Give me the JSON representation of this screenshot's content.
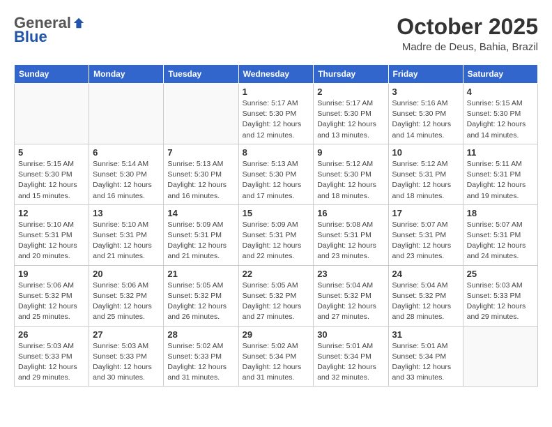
{
  "header": {
    "logo_general": "General",
    "logo_blue": "Blue",
    "month_title": "October 2025",
    "location": "Madre de Deus, Bahia, Brazil"
  },
  "weekdays": [
    "Sunday",
    "Monday",
    "Tuesday",
    "Wednesday",
    "Thursday",
    "Friday",
    "Saturday"
  ],
  "weeks": [
    [
      {
        "day": "",
        "info": ""
      },
      {
        "day": "",
        "info": ""
      },
      {
        "day": "",
        "info": ""
      },
      {
        "day": "1",
        "info": "Sunrise: 5:17 AM\nSunset: 5:30 PM\nDaylight: 12 hours and 12 minutes."
      },
      {
        "day": "2",
        "info": "Sunrise: 5:17 AM\nSunset: 5:30 PM\nDaylight: 12 hours and 13 minutes."
      },
      {
        "day": "3",
        "info": "Sunrise: 5:16 AM\nSunset: 5:30 PM\nDaylight: 12 hours and 14 minutes."
      },
      {
        "day": "4",
        "info": "Sunrise: 5:15 AM\nSunset: 5:30 PM\nDaylight: 12 hours and 14 minutes."
      }
    ],
    [
      {
        "day": "5",
        "info": "Sunrise: 5:15 AM\nSunset: 5:30 PM\nDaylight: 12 hours and 15 minutes."
      },
      {
        "day": "6",
        "info": "Sunrise: 5:14 AM\nSunset: 5:30 PM\nDaylight: 12 hours and 16 minutes."
      },
      {
        "day": "7",
        "info": "Sunrise: 5:13 AM\nSunset: 5:30 PM\nDaylight: 12 hours and 16 minutes."
      },
      {
        "day": "8",
        "info": "Sunrise: 5:13 AM\nSunset: 5:30 PM\nDaylight: 12 hours and 17 minutes."
      },
      {
        "day": "9",
        "info": "Sunrise: 5:12 AM\nSunset: 5:30 PM\nDaylight: 12 hours and 18 minutes."
      },
      {
        "day": "10",
        "info": "Sunrise: 5:12 AM\nSunset: 5:31 PM\nDaylight: 12 hours and 18 minutes."
      },
      {
        "day": "11",
        "info": "Sunrise: 5:11 AM\nSunset: 5:31 PM\nDaylight: 12 hours and 19 minutes."
      }
    ],
    [
      {
        "day": "12",
        "info": "Sunrise: 5:10 AM\nSunset: 5:31 PM\nDaylight: 12 hours and 20 minutes."
      },
      {
        "day": "13",
        "info": "Sunrise: 5:10 AM\nSunset: 5:31 PM\nDaylight: 12 hours and 21 minutes."
      },
      {
        "day": "14",
        "info": "Sunrise: 5:09 AM\nSunset: 5:31 PM\nDaylight: 12 hours and 21 minutes."
      },
      {
        "day": "15",
        "info": "Sunrise: 5:09 AM\nSunset: 5:31 PM\nDaylight: 12 hours and 22 minutes."
      },
      {
        "day": "16",
        "info": "Sunrise: 5:08 AM\nSunset: 5:31 PM\nDaylight: 12 hours and 23 minutes."
      },
      {
        "day": "17",
        "info": "Sunrise: 5:07 AM\nSunset: 5:31 PM\nDaylight: 12 hours and 23 minutes."
      },
      {
        "day": "18",
        "info": "Sunrise: 5:07 AM\nSunset: 5:31 PM\nDaylight: 12 hours and 24 minutes."
      }
    ],
    [
      {
        "day": "19",
        "info": "Sunrise: 5:06 AM\nSunset: 5:32 PM\nDaylight: 12 hours and 25 minutes."
      },
      {
        "day": "20",
        "info": "Sunrise: 5:06 AM\nSunset: 5:32 PM\nDaylight: 12 hours and 25 minutes."
      },
      {
        "day": "21",
        "info": "Sunrise: 5:05 AM\nSunset: 5:32 PM\nDaylight: 12 hours and 26 minutes."
      },
      {
        "day": "22",
        "info": "Sunrise: 5:05 AM\nSunset: 5:32 PM\nDaylight: 12 hours and 27 minutes."
      },
      {
        "day": "23",
        "info": "Sunrise: 5:04 AM\nSunset: 5:32 PM\nDaylight: 12 hours and 27 minutes."
      },
      {
        "day": "24",
        "info": "Sunrise: 5:04 AM\nSunset: 5:32 PM\nDaylight: 12 hours and 28 minutes."
      },
      {
        "day": "25",
        "info": "Sunrise: 5:03 AM\nSunset: 5:33 PM\nDaylight: 12 hours and 29 minutes."
      }
    ],
    [
      {
        "day": "26",
        "info": "Sunrise: 5:03 AM\nSunset: 5:33 PM\nDaylight: 12 hours and 29 minutes."
      },
      {
        "day": "27",
        "info": "Sunrise: 5:03 AM\nSunset: 5:33 PM\nDaylight: 12 hours and 30 minutes."
      },
      {
        "day": "28",
        "info": "Sunrise: 5:02 AM\nSunset: 5:33 PM\nDaylight: 12 hours and 31 minutes."
      },
      {
        "day": "29",
        "info": "Sunrise: 5:02 AM\nSunset: 5:34 PM\nDaylight: 12 hours and 31 minutes."
      },
      {
        "day": "30",
        "info": "Sunrise: 5:01 AM\nSunset: 5:34 PM\nDaylight: 12 hours and 32 minutes."
      },
      {
        "day": "31",
        "info": "Sunrise: 5:01 AM\nSunset: 5:34 PM\nDaylight: 12 hours and 33 minutes."
      },
      {
        "day": "",
        "info": ""
      }
    ]
  ]
}
